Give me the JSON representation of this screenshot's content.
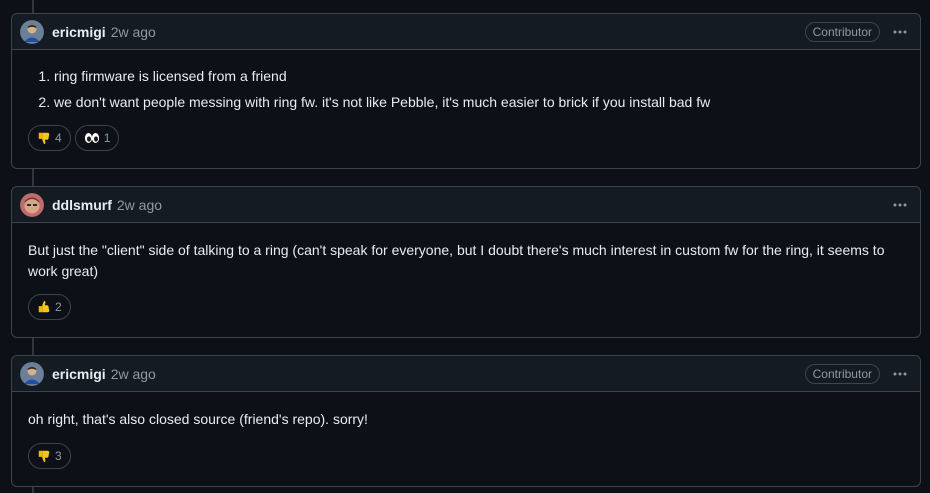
{
  "comments": [
    {
      "author": "ericmigi",
      "time": "2w ago",
      "badge": "Contributor",
      "list_items": [
        "ring firmware is licensed from a friend",
        "we don't want people messing with ring fw. it's not like Pebble, it's much easier to brick if you install bad fw"
      ],
      "reactions": [
        {
          "emoji": "thumbs-down",
          "count": "4"
        },
        {
          "emoji": "eyes",
          "count": "1"
        }
      ]
    },
    {
      "author": "ddlsmurf",
      "time": "2w ago",
      "text": "But just the \"client\" side of talking to a ring (can't speak for everyone, but I doubt there's much interest in custom fw for the ring, it seems to work great)",
      "reactions": [
        {
          "emoji": "thumbs-up",
          "count": "2"
        }
      ]
    },
    {
      "author": "ericmigi",
      "time": "2w ago",
      "badge": "Contributor",
      "text": "oh right, that's also closed source (friend's repo). sorry!",
      "reactions": [
        {
          "emoji": "thumbs-down",
          "count": "3"
        }
      ]
    }
  ],
  "colors": {
    "background": "#0d1117",
    "header_bg": "#151b23",
    "border": "#3d444d",
    "text": "#e6edf3",
    "muted": "#9198a1"
  }
}
